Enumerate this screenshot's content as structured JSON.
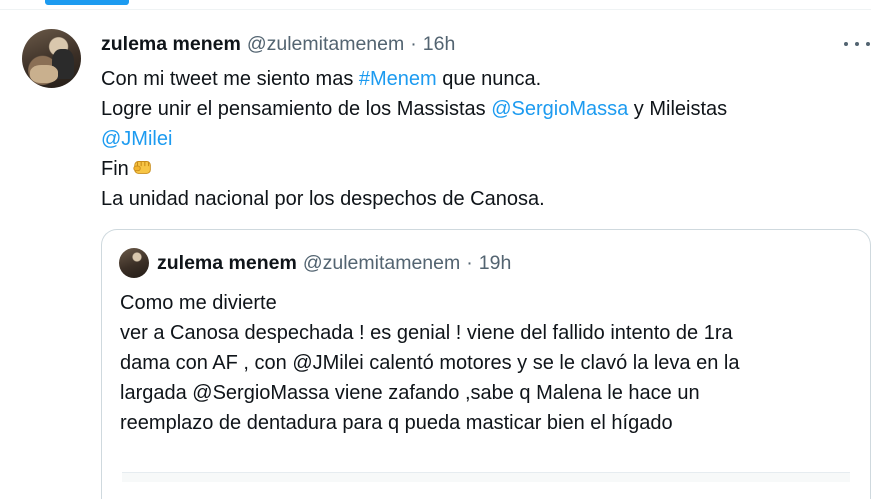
{
  "tweet": {
    "author": {
      "name": "zulema menem",
      "handle": "@zulemitamenem",
      "separator": "·",
      "time": "16h"
    },
    "lines": [
      [
        {
          "t": "Con mi tweet me siento mas "
        },
        {
          "t": "#Menem",
          "link": true
        },
        {
          "t": " que nunca."
        }
      ],
      [
        {
          "t": "Logre unir el pensamiento de los Massistas "
        },
        {
          "t": "@SergioMassa",
          "link": true
        },
        {
          "t": " y Mileistas"
        }
      ],
      [
        {
          "t": "@JMilei",
          "link": true
        }
      ],
      [
        {
          "t": "Fin"
        }
      ],
      [
        {
          "t": "La unidad nacional por los despechos de Canosa."
        }
      ]
    ],
    "emoji": "oncoming-fist-icon",
    "more_icon": "more-horizontal-icon",
    "quoted": {
      "author": {
        "name": "zulema menem",
        "handle": "@zulemitamenem",
        "separator": "·",
        "time": "19h"
      },
      "lines": [
        "Como me divierte",
        "ver a Canosa despechada ! es genial ! viene del fallido intento de 1ra",
        "dama con AF , con @JMilei calentó motores y se le clavó la leva en la",
        "largada @SergioMassa viene zafando ,sabe q Malena le hace un",
        "reemplazo de dentadura para q pueda masticar bien el hígado"
      ]
    }
  },
  "colors": {
    "link": "#1d9bf0",
    "text": "#0f1419",
    "secondary": "#536471",
    "border": "#cfd9de"
  }
}
